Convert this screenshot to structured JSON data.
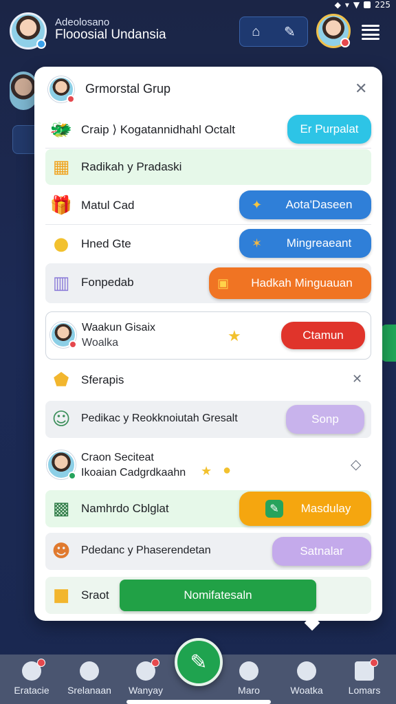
{
  "status": {
    "time": "225"
  },
  "header": {
    "subtitle": "Adeolosano",
    "title": "Flooosial Undansia",
    "actions": [
      "home-icon",
      "edit-icon"
    ]
  },
  "panel": {
    "title": "Grmorstal Grup",
    "rows": [
      {
        "label": "Craip ⟩ Kogatannidhahl Octalt",
        "button": "Er Purpalat",
        "button_color": "#2dc4e6"
      },
      {
        "label": "Radikah y Pradaski"
      },
      {
        "label": "Matul Cad",
        "button": "Aota'Daseen",
        "button_color": "#2f7fd8"
      },
      {
        "label": "Hned Gte",
        "button": "Mingreaeant",
        "button_color": "#2f7fd8"
      },
      {
        "label": "Fonpedab",
        "button": "Hadkah Minguauan",
        "button_color": "#f07423"
      },
      {
        "label": "Waakun Gisaix",
        "sublabel": "Woalka",
        "button": "Ctamun",
        "button_color": "#e0342b"
      },
      {
        "label": "Sferapis"
      },
      {
        "label": "Pedikac y Reokknoiutah Gresalt",
        "button": "Sonp",
        "button_color": "#c8b3ec"
      },
      {
        "label": "Craon Seciteat",
        "sublabel": "Ikoaian Cadgrdkaahn"
      },
      {
        "label": "Namhrdo Cblglat",
        "button": "Masdulay",
        "button_color": "#f5a60f"
      },
      {
        "label": "Pdedanc y Phaserendetan",
        "button": "Satnalar",
        "button_color": "#c4aaeb"
      },
      {
        "label": "Sraot",
        "button": "Nomifatesaln",
        "button_color": "#21a146"
      }
    ]
  },
  "bottom_nav": [
    {
      "label": "Eratacie",
      "badge": true
    },
    {
      "label": "Srelanaan",
      "badge": false
    },
    {
      "label": "Wanyay",
      "badge": true
    },
    {
      "label": "Maro",
      "badge": false
    },
    {
      "label": "Woatka",
      "badge": false
    },
    {
      "label": "Lomars",
      "badge": true
    }
  ]
}
